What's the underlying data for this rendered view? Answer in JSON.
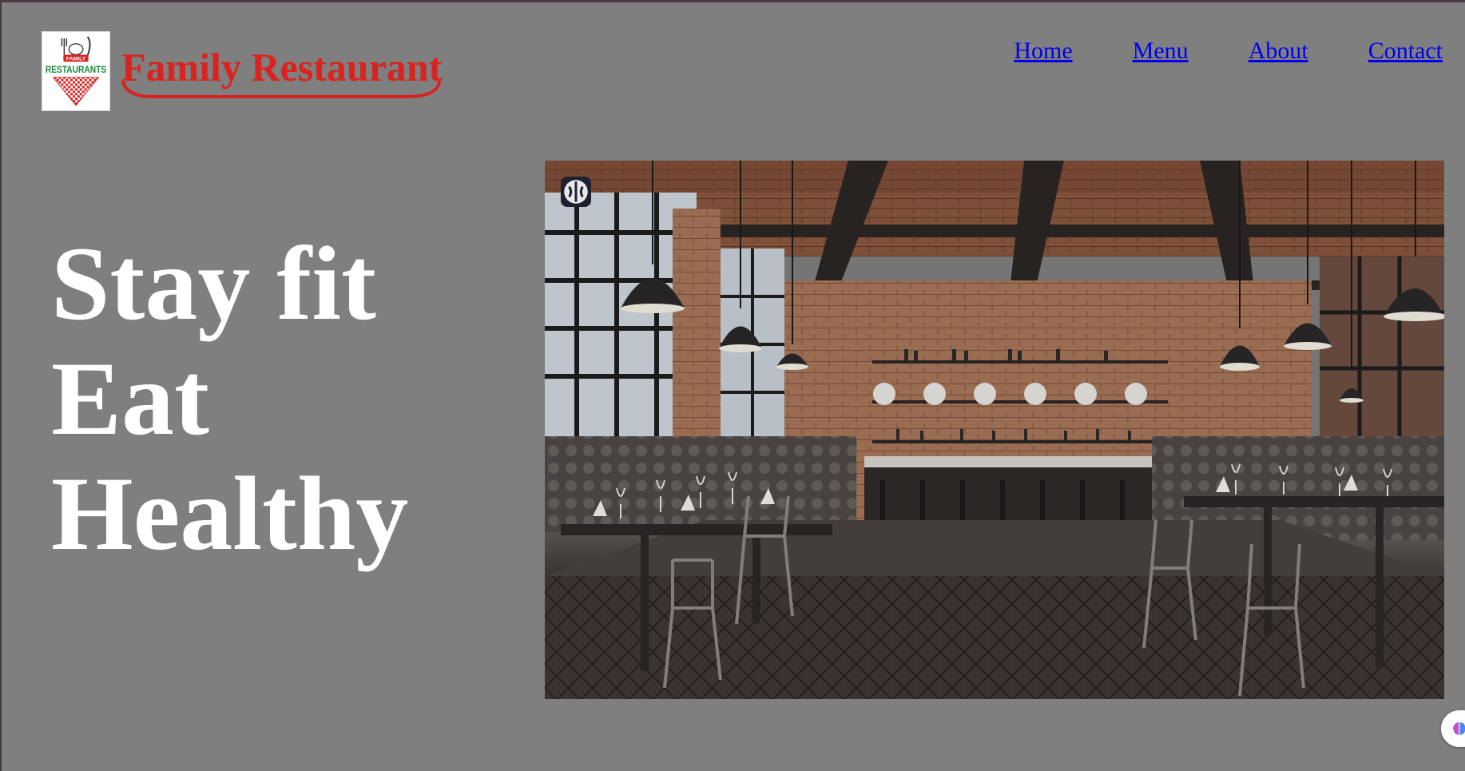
{
  "header": {
    "brand": "Family Restaurant",
    "logo": {
      "icon": "family-restaurants-logo",
      "text_top": "FAMILY",
      "text_main": "RESTAURANTS",
      "colors": {
        "red": "#d8231f",
        "green": "#1a8a3a"
      }
    }
  },
  "nav": {
    "items": [
      {
        "label": "Home"
      },
      {
        "label": "Menu"
      },
      {
        "label": "About"
      },
      {
        "label": "Contact"
      }
    ]
  },
  "hero": {
    "lines": [
      "Stay fit",
      "Eat",
      "Healthy"
    ]
  },
  "image": {
    "subject": "restaurant-interior-photo",
    "badge_icon": "ai-brain-icon"
  },
  "floating_button": {
    "icon": "brain-assistant-icon"
  },
  "colors": {
    "page_background": "#7f7f7f",
    "brand": "#d8231f",
    "link": "#0000ee",
    "hero_text": "#ffffff"
  }
}
